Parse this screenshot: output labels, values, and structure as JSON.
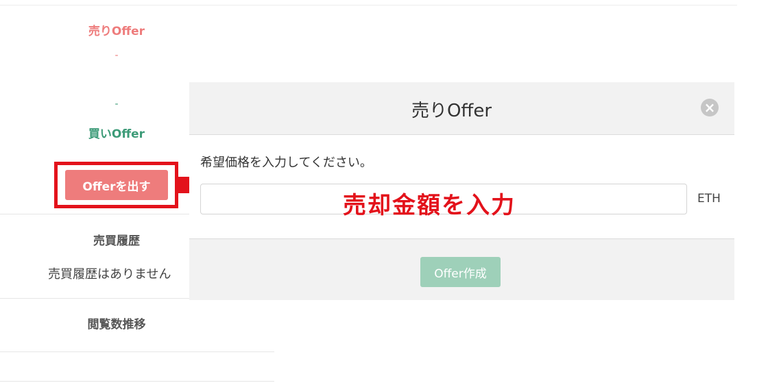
{
  "offers": {
    "sell_title": "売りOffer",
    "sell_value": "-",
    "buy_value": "-",
    "buy_title": "買いOffer",
    "make_offer_label": "Offerを出す"
  },
  "history": {
    "title": "売買履歴",
    "empty_text": "売買履歴はありません"
  },
  "views": {
    "title": "閲覧数推移"
  },
  "modal": {
    "title": "売りOffer",
    "close_icon": "close-icon",
    "prompt": "希望価格を入力してください。",
    "input_value": "",
    "input_placeholder": "",
    "unit": "ETH",
    "create_label": "Offer作成"
  },
  "annotation": {
    "text": "売却金額を入力",
    "color": "#e3121b"
  },
  "colors": {
    "sell": "#ee7c7c",
    "buy": "#3d9b78",
    "create_button": "#9ed0b9",
    "highlight": "#e3121b"
  }
}
